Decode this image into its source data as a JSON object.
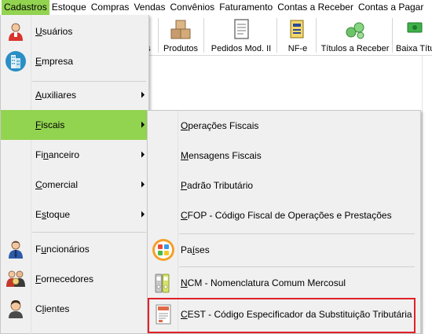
{
  "menubar": {
    "items": [
      {
        "label": "Cadastros"
      },
      {
        "label": "Estoque"
      },
      {
        "label": "Compras"
      },
      {
        "label": "Vendas"
      },
      {
        "label": "Convênios"
      },
      {
        "label": "Faturamento"
      },
      {
        "label": "Contas a Receber"
      },
      {
        "label": "Contas a Pagar"
      }
    ]
  },
  "toolbar": {
    "buttons": [
      {
        "label": "s",
        "icon": "users-icon"
      },
      {
        "label": "Produtos",
        "icon": "boxes-icon"
      },
      {
        "label": "Pedidos Mod. II",
        "icon": "document-icon"
      },
      {
        "label": "NF-e",
        "icon": "nfe-icon"
      },
      {
        "label": "Títulos a Receber",
        "icon": "coins-icon"
      },
      {
        "label": "Baixa Títu",
        "icon": "cash-icon"
      }
    ]
  },
  "cadastros_menu": {
    "items": [
      {
        "label": "Usuários",
        "mnemonic": "U",
        "icon": "user-icon",
        "has_submenu": false
      },
      {
        "label": "Empresa",
        "mnemonic": "E",
        "icon": "building-icon",
        "has_submenu": false
      },
      {
        "label": "Auxiliares",
        "mnemonic": "A",
        "icon": "",
        "has_submenu": true
      },
      {
        "label": "Fiscais",
        "mnemonic": "F",
        "icon": "",
        "has_submenu": true,
        "selected": true
      },
      {
        "label": "Financeiro",
        "mnemonic": "n",
        "icon": "",
        "has_submenu": true
      },
      {
        "label": "Comercial",
        "mnemonic": "C",
        "icon": "",
        "has_submenu": true
      },
      {
        "label": "Estoque",
        "mnemonic": "s",
        "icon": "",
        "has_submenu": true
      },
      {
        "label": "Funcionários",
        "mnemonic": "u",
        "icon": "employee-icon",
        "has_submenu": false
      },
      {
        "label": "Fornecedores",
        "mnemonic": "F",
        "icon": "suppliers-icon",
        "has_submenu": false
      },
      {
        "label": "Clientes",
        "mnemonic": "l",
        "icon": "client-icon",
        "has_submenu": false
      }
    ]
  },
  "fiscais_submenu": {
    "items": [
      {
        "label": "Operações Fiscais",
        "mnemonic": "O",
        "icon": ""
      },
      {
        "label": "Mensagens Fiscais",
        "mnemonic": "M",
        "icon": ""
      },
      {
        "label": "Padrão Tributário",
        "mnemonic": "P",
        "icon": ""
      },
      {
        "label": "CFOP - Código Fiscal de Operações e Prestações",
        "mnemonic": "C",
        "icon": ""
      },
      {
        "label": "Países",
        "mnemonic": "í",
        "icon": "countries-icon"
      },
      {
        "label": "NCM - Nomenclatura Comum Mercosul",
        "mnemonic": "N",
        "icon": "binders-icon"
      },
      {
        "label": "CEST - Código Especificador da Substituição Tributária",
        "mnemonic": "C",
        "icon": "tax-document-icon",
        "highlighted": true
      }
    ]
  },
  "colors": {
    "menu_highlight": "#92d350",
    "menu_background": "#f0f0f0",
    "annotation_box": "#e0202a"
  }
}
